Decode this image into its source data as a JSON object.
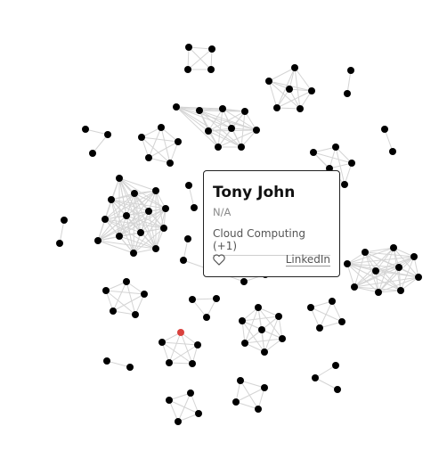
{
  "tooltip": {
    "name": "Tony John",
    "subtitle": "N/A",
    "tags": "Cloud Computing (+1)",
    "like_icon": "heart-icon",
    "link_label": "LinkedIn"
  },
  "colors": {
    "node": "#000000",
    "node_highlight": "#d9413d",
    "edge": "#d4d4d4",
    "tooltip_border": "#222222"
  }
}
